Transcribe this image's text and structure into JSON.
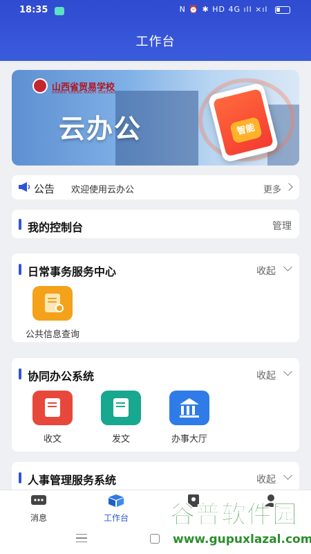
{
  "status_bar": {
    "time": "18:35",
    "icons": "N ⏰ ✱ HD 4G ıll ×ıl"
  },
  "header": {
    "title": "工作台"
  },
  "banner": {
    "school_name": "山西省贸易学校",
    "school_name_en": "SHANXI SHENG MAOYI XUEXIAO",
    "heading": "云办公",
    "badge": "智能"
  },
  "notice": {
    "label": "公告",
    "text": "欢迎使用云办公",
    "more": "更多"
  },
  "console": {
    "title": "我的控制台",
    "action": "管理"
  },
  "sections": {
    "daily": {
      "title": "日常事务服务中心",
      "action": "收起",
      "apps": [
        {
          "label": "公共信息查询",
          "icon": "info-query-icon",
          "color": "#f3a21a"
        }
      ]
    },
    "collab": {
      "title": "协同办公系统",
      "action": "收起",
      "apps": [
        {
          "label": "收文",
          "icon": "receive-doc-icon",
          "color": "#e8473b"
        },
        {
          "label": "发文",
          "icon": "send-doc-icon",
          "color": "#17a88f"
        },
        {
          "label": "办事大厅",
          "icon": "service-hall-icon",
          "color": "#2f7be8"
        }
      ]
    },
    "hr": {
      "title": "人事管理服务系统",
      "action": "收起"
    }
  },
  "tabs": [
    {
      "label": "消息",
      "icon": "message-icon"
    },
    {
      "label": "工作台",
      "icon": "workbench-icon",
      "active": true
    },
    {
      "label": "",
      "icon": "contacts-icon"
    },
    {
      "label": "",
      "icon": "profile-icon"
    }
  ],
  "watermark": {
    "cn": "谷普软件园",
    "url": "www.gupuxlazal.com"
  },
  "colors": {
    "primary": "#2f55d4",
    "header": "#3b5bdc",
    "background": "#eef0f3"
  }
}
